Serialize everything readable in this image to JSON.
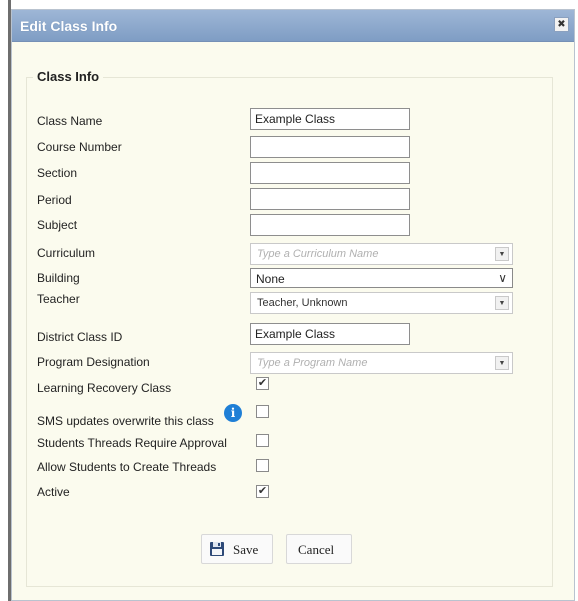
{
  "dialog": {
    "title": "Edit Class Info",
    "close_icon": "close-icon"
  },
  "section": {
    "legend": "Class Info"
  },
  "fields": {
    "class_name": {
      "label": "Class Name",
      "value": "Example Class"
    },
    "course_number": {
      "label": "Course Number",
      "value": ""
    },
    "section": {
      "label": "Section",
      "value": ""
    },
    "period": {
      "label": "Period",
      "value": ""
    },
    "subject": {
      "label": "Subject",
      "value": ""
    },
    "curriculum": {
      "label": "Curriculum",
      "placeholder": "Type a Curriculum Name"
    },
    "building": {
      "label": "Building",
      "value": "None"
    },
    "teacher": {
      "label": "Teacher",
      "value": "Teacher, Unknown"
    },
    "district_class_id": {
      "label": "District Class ID",
      "value": "Example Class"
    },
    "program_designation": {
      "label": "Program Designation",
      "placeholder": "Type a Program Name"
    },
    "learning_recovery_class": {
      "label": "Learning Recovery Class",
      "checked": true
    },
    "sms_updates": {
      "label": "SMS updates overwrite this class",
      "checked": false,
      "info_icon": "info-icon"
    },
    "students_threads_require_approval": {
      "label": "Students Threads Require Approval",
      "checked": false
    },
    "allow_students_create_threads": {
      "label": "Allow Students to Create Threads",
      "checked": false
    },
    "active": {
      "label": "Active",
      "checked": true
    }
  },
  "buttons": {
    "save": {
      "label": "Save",
      "icon": "floppy-disk-icon"
    },
    "cancel": {
      "label": "Cancel"
    }
  },
  "colors": {
    "titlebar": "#8ea9cf",
    "dialog_bg": "#fbfbee",
    "info_blue": "#1f7fd6"
  }
}
